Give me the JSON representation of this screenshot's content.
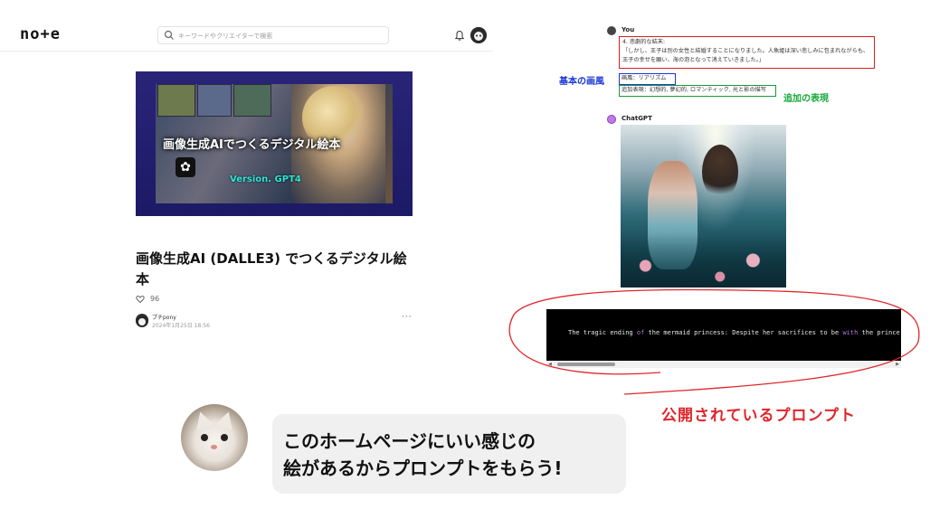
{
  "note": {
    "logo": "no+e",
    "search_placeholder": "キーワードやクリエイターで検索",
    "hero": {
      "title": "画像生成AIでつくるデジタル絵本",
      "version": "Version. GPT4"
    },
    "article_title": "画像生成AI (DALLE3) でつくるデジタル絵本",
    "likes": "96",
    "author": "プチpony",
    "date": "2024年1月25日 18:56",
    "more": "···"
  },
  "chat": {
    "user_name": "You",
    "prompt_heading": "4. 悲劇的な結末:",
    "prompt_body": "「しかし、王子は別の女性と結婚することになりました。人魚姫は深い悲しみに包まれながらも、王子の幸せを願い、海の泡となって消えていきました。」",
    "style_line": "画風：リアリズム",
    "extra_line": "追加表現：幻想的, 夢幻的, ロマンティック, 光と影の描写",
    "assistant_name": "ChatGPT"
  },
  "annotations": {
    "base_style": "基本の画風",
    "extra_expression": "追加の表現",
    "public_prompt": "公開されているプロンプト"
  },
  "code": {
    "part1": "The tragic ending ",
    "kw1": "of",
    "part2": " the mermaid princess: Despite her sacrifices to be ",
    "kw2": "with",
    "part3": " the prince "
  },
  "speech": {
    "text": "このホームページにいい感じの\n絵があるからプロンプトをもらう!"
  },
  "colors": {
    "red": "#e0262a",
    "blue": "#1a37d6",
    "green": "#18a83a"
  }
}
